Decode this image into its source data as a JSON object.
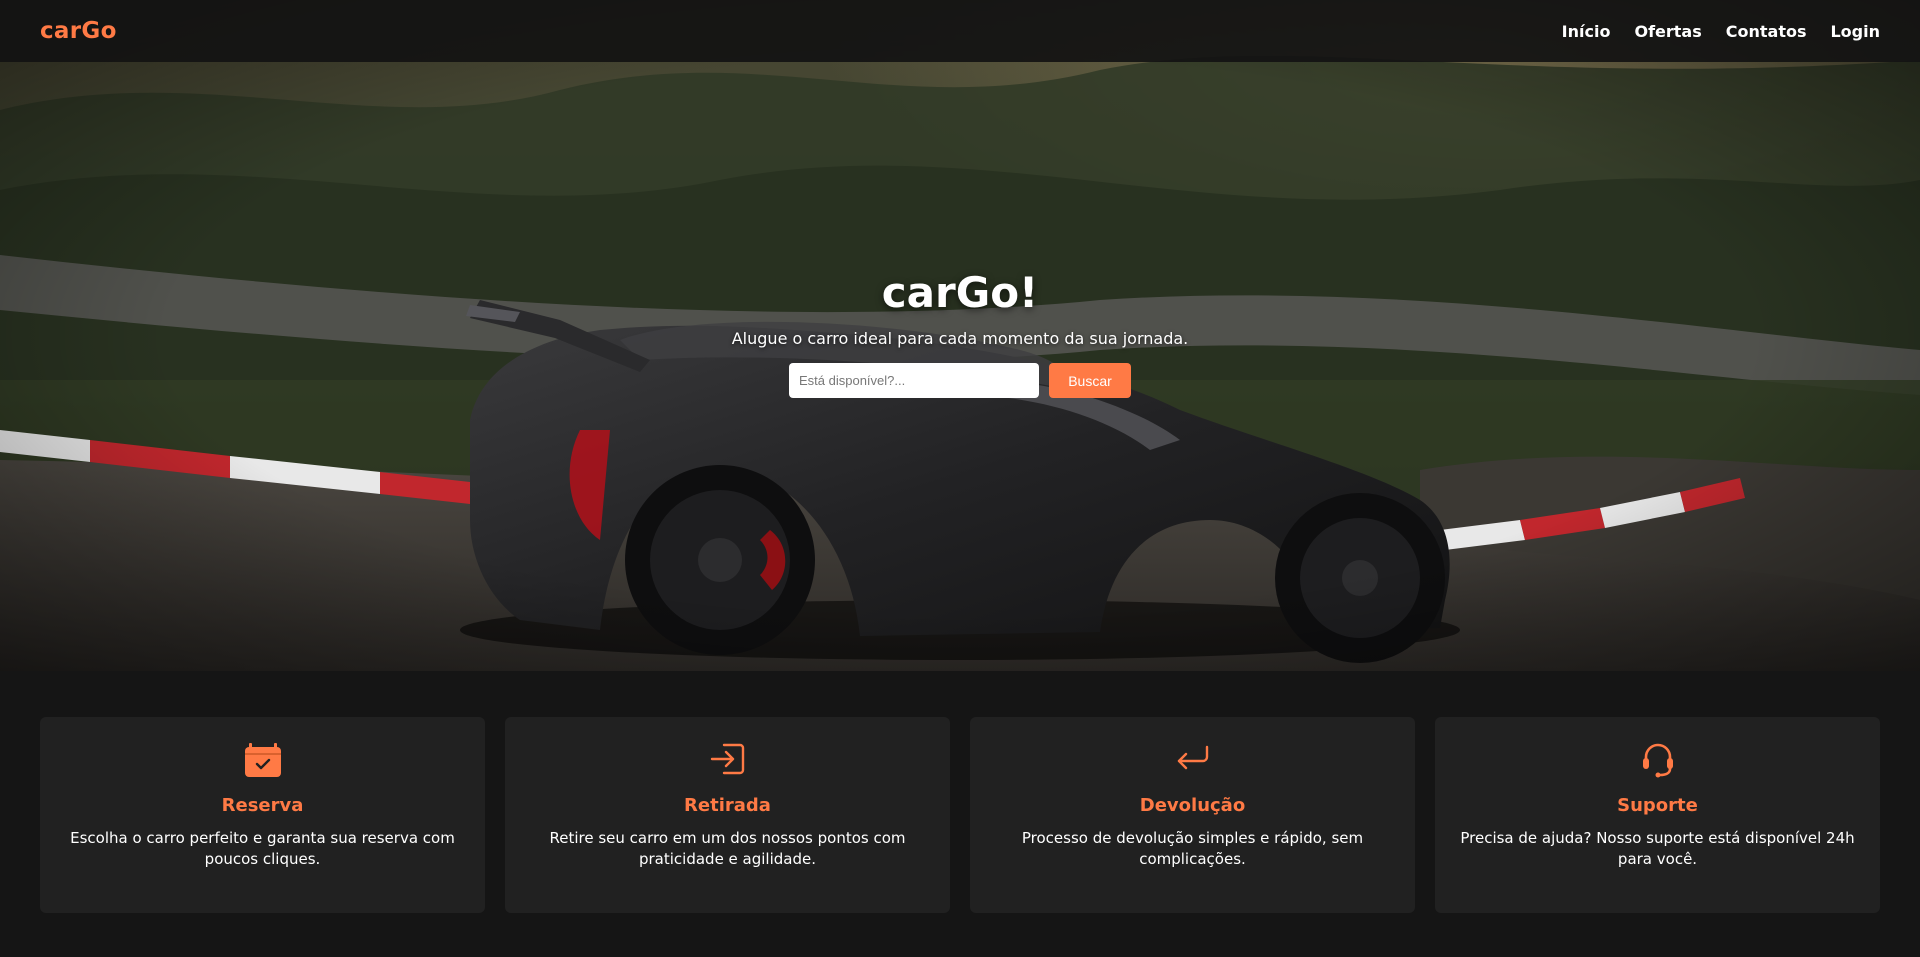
{
  "brand": {
    "logo": "carGo",
    "accent_color": "#ff7a45"
  },
  "nav": {
    "items": [
      "Início",
      "Ofertas",
      "Contatos",
      "Login"
    ]
  },
  "hero": {
    "title": "carGo!",
    "subtitle": "Alugue o carro ideal para cada momento da sua jornada.",
    "search": {
      "placeholder": "Está disponível?...",
      "value": ""
    },
    "search_button": "Buscar"
  },
  "features": [
    {
      "icon": "calendar-check-icon",
      "title": "Reserva",
      "text": "Escolha o carro perfeito e garanta sua reserva com poucos cliques."
    },
    {
      "icon": "sign-in-icon",
      "title": "Retirada",
      "text": "Retire seu carro em um dos nossos pontos com praticidade e agilidade."
    },
    {
      "icon": "return-arrow-icon",
      "title": "Devolução",
      "text": "Processo de devolução simples e rápido, sem complicações."
    },
    {
      "icon": "headset-icon",
      "title": "Suporte",
      "text": "Precisa de ajuda? Nosso suporte está disponível 24h para você."
    }
  ]
}
